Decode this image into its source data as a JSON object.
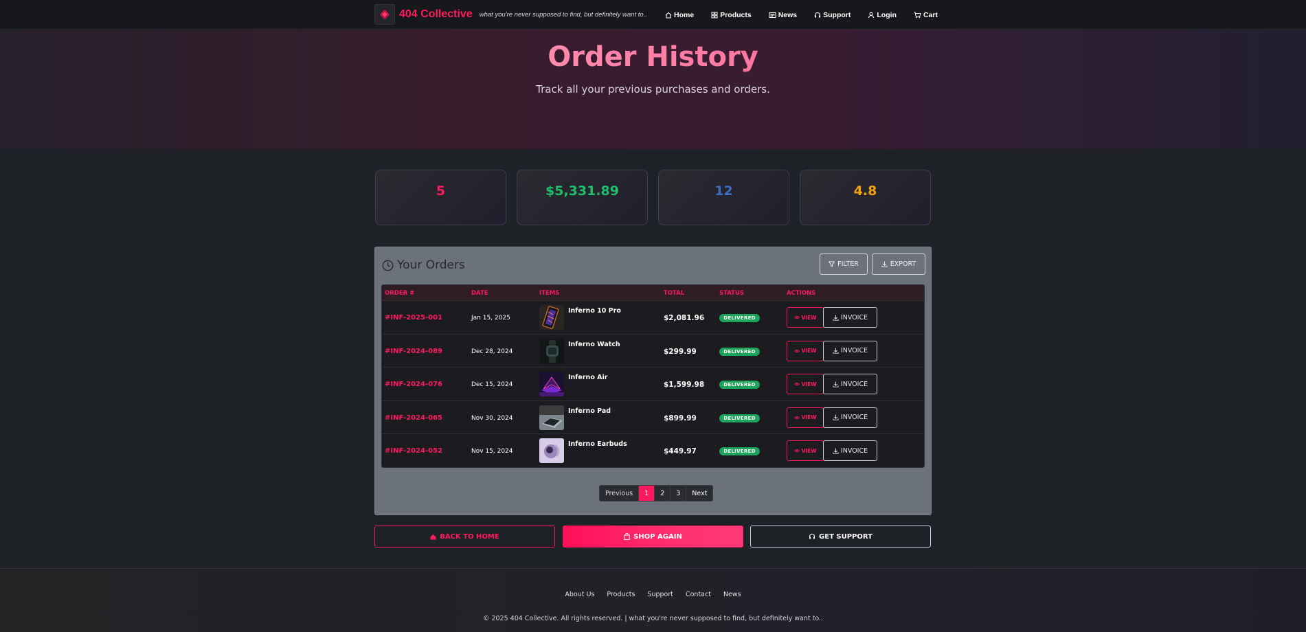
{
  "header": {
    "brand": "404 Collective",
    "tagline": "what you're never supposed to find, but definitely want to..",
    "nav": [
      {
        "label": "Home",
        "icon": "home-icon"
      },
      {
        "label": "Products",
        "icon": "grid-icon"
      },
      {
        "label": "News",
        "icon": "newspaper-icon"
      },
      {
        "label": "Support",
        "icon": "headset-icon"
      },
      {
        "label": "Login",
        "icon": "user-icon"
      },
      {
        "label": "Cart",
        "icon": "cart-icon"
      }
    ]
  },
  "hero": {
    "title": "Order History",
    "subtitle": "Track all your previous purchases and orders."
  },
  "stats": [
    {
      "value": "5",
      "color": "#ff1a5e"
    },
    {
      "value": "$5,331.89",
      "color": "#1fbf6a"
    },
    {
      "value": "12",
      "color": "#3f6bc0"
    },
    {
      "value": "4.8",
      "color": "#f5a10e"
    }
  ],
  "orders": {
    "title": "Your Orders",
    "filter_label": "FILTER",
    "export_label": "EXPORT",
    "columns": [
      "ORDER #",
      "DATE",
      "ITEMS",
      "TOTAL",
      "STATUS",
      "ACTIONS"
    ],
    "rows": [
      {
        "order": "#INF-2025-001",
        "date": "Jan 15, 2025",
        "item": "Inferno 10 Pro",
        "total": "$2,081.96",
        "status": "DELIVERED",
        "view": "VIEW",
        "invoice": "INVOICE"
      },
      {
        "order": "#INF-2024-089",
        "date": "Dec 28, 2024",
        "item": "Inferno Watch",
        "total": "$299.99",
        "status": "DELIVERED",
        "view": "VIEW",
        "invoice": "INVOICE"
      },
      {
        "order": "#INF-2024-076",
        "date": "Dec 15, 2024",
        "item": "Inferno Air",
        "total": "$1,599.98",
        "status": "DELIVERED",
        "view": "VIEW",
        "invoice": "INVOICE"
      },
      {
        "order": "#INF-2024-065",
        "date": "Nov 30, 2024",
        "item": "Inferno Pad",
        "total": "$899.99",
        "status": "DELIVERED",
        "view": "VIEW",
        "invoice": "INVOICE"
      },
      {
        "order": "#INF-2024-052",
        "date": "Nov 15, 2024",
        "item": "Inferno Earbuds",
        "total": "$449.97",
        "status": "DELIVERED",
        "view": "VIEW",
        "invoice": "INVOICE"
      }
    ],
    "pagination": {
      "previous": "Previous",
      "pages": [
        "1",
        "2",
        "3"
      ],
      "active": "1",
      "next": "Next"
    }
  },
  "actions": {
    "home": "BACK TO HOME",
    "shop": "SHOP AGAIN",
    "support": "GET SUPPORT"
  },
  "footer": {
    "links": [
      "About Us",
      "Products",
      "Support",
      "Contact",
      "News"
    ],
    "copyright": "© 2025 404 Collective. All rights reserved. | what you're never supposed to find, but definitely want to.."
  },
  "colors": {
    "accent": "#ff1a5e",
    "delivered": "#1ea45a"
  }
}
